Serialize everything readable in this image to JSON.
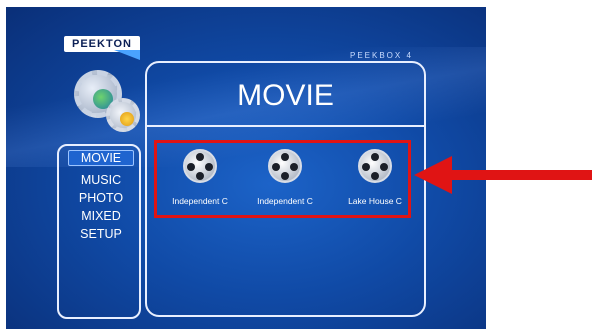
{
  "app": {
    "brand": "PEEKTON",
    "model": "PEEKBOX 4"
  },
  "sidebar": {
    "items": [
      {
        "label": "MOVIE",
        "selected": true
      },
      {
        "label": "MUSIC",
        "selected": false
      },
      {
        "label": "PHOTO",
        "selected": false
      },
      {
        "label": "MIXED",
        "selected": false
      },
      {
        "label": "SETUP",
        "selected": false
      }
    ]
  },
  "main": {
    "title": "MOVIE",
    "files": [
      {
        "label": "Independent C",
        "icon": "film-reel-icon"
      },
      {
        "label": "Independent C",
        "icon": "film-reel-icon"
      },
      {
        "label": "Lake House C",
        "icon": "film-reel-icon"
      }
    ]
  },
  "annotation": {
    "arrow_color": "#e01414",
    "highlight_color": "#e01414"
  }
}
